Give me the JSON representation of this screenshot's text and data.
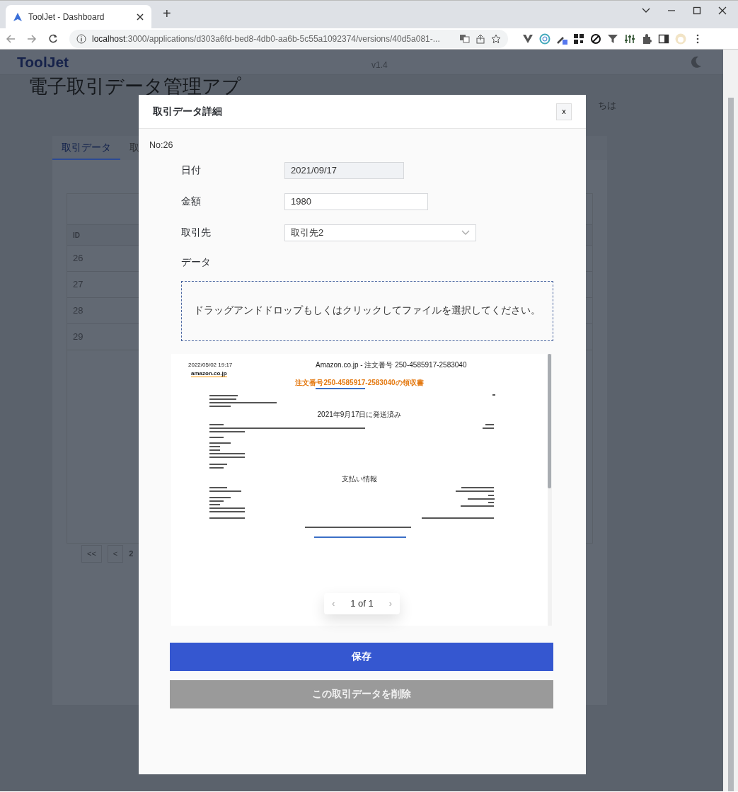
{
  "browser": {
    "tab_title": "ToolJet - Dashboard",
    "new_tab": "+",
    "url_host": "localhost",
    "url_rest": ":3000/applications/d303a6fd-bed8-4db0-aa6b-5c55a1092374/versions/40d5a081-..."
  },
  "app": {
    "logo": "ToolJet",
    "version": "v1.4",
    "title": "電子取引データ管理アプ",
    "greeting": "ちは",
    "tabs": [
      {
        "label": "取引データ",
        "selected": true
      },
      {
        "label": "取",
        "selected": false
      }
    ],
    "table": {
      "columns": [
        "ID"
      ],
      "rows": [
        "26",
        "27",
        "28",
        "29"
      ]
    },
    "pagination": [
      "<<",
      "<",
      "2"
    ]
  },
  "modal": {
    "title": "取引データ詳細",
    "close": "x",
    "record_no": "No:26",
    "fields": [
      {
        "label": "日付",
        "kind": "date",
        "value": "2021/09/17",
        "disabled": true
      },
      {
        "label": "金額",
        "kind": "text",
        "value": "1980",
        "disabled": false
      },
      {
        "label": "取引先",
        "kind": "select",
        "value": "取引先2",
        "disabled": false
      }
    ],
    "data_label": "データ",
    "dropzone": "ドラッグアンドドロップもしくはクリックしてファイルを選択してください。",
    "preview": {
      "timestamp": "2022/05/02 19:17",
      "doc_title": "Amazon.co.jp - 注文番号 250-4585917-2583040",
      "logo": "amazon.co.jp",
      "heading": "注文番号250-4585917-2583040の領収書",
      "shipped": "2021年9月17日に発送済み",
      "payment_heading": "支払い情報",
      "pager": {
        "prev": "‹",
        "page": "1 of 1",
        "next": "›"
      }
    },
    "buttons": [
      {
        "label": "保存",
        "kind": "primary"
      },
      {
        "label": "この取引データを削除",
        "kind": "danger-muted"
      }
    ]
  }
}
